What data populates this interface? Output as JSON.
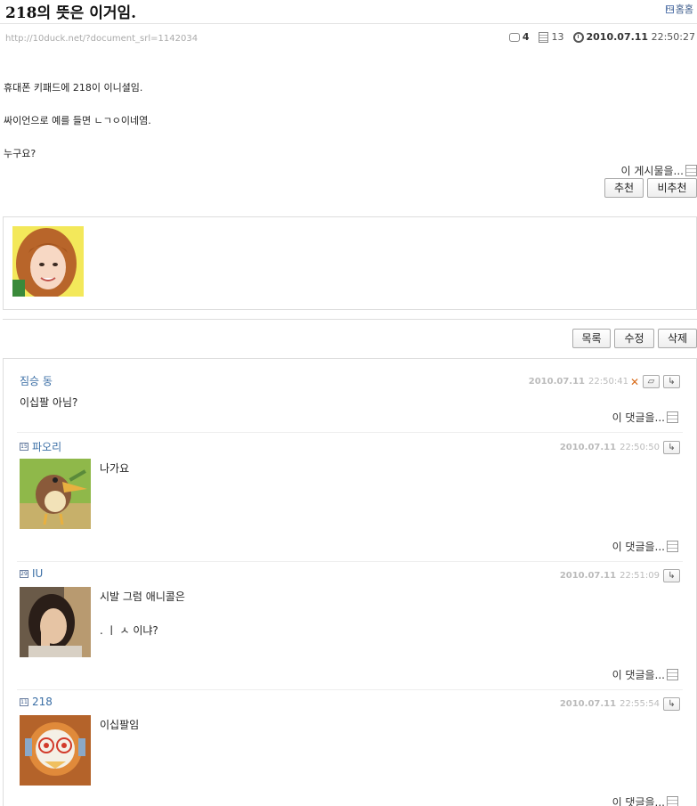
{
  "post": {
    "title": "218의 뜻은 이거임.",
    "home_label": "홈홈",
    "url": "http://10duck.net/?document_srl=1142034",
    "comment_count": "4",
    "view_count": "13",
    "date": "2010.07.11",
    "time": "22:50:27",
    "body": [
      "휴대폰 키패드에 218이 이니셜임.",
      "싸이언으로 예를 들면 ㄴㄱㅇ이네염.",
      "누구요?"
    ],
    "attach_label": "이 게시물을...",
    "recommend_label": "추천",
    "unrecommend_label": "비추천"
  },
  "actions": {
    "list_label": "목록",
    "edit_label": "수정",
    "delete_label": "삭제"
  },
  "comments": [
    {
      "author": "짐승 동",
      "level": "",
      "date": "2010.07.11",
      "time": "22:50:41",
      "lines": [
        "이십팔 아님?"
      ],
      "reply_label": "이 댓글을..."
    },
    {
      "author": "파오리",
      "level": "15",
      "date": "2010.07.11",
      "time": "22:50:50",
      "lines": [
        "나가요"
      ],
      "reply_label": "이 댓글을..."
    },
    {
      "author": "IU",
      "level": "29",
      "date": "2010.07.11",
      "time": "22:51:09",
      "lines": [
        "시발 그럼 애니콜은",
        ". ㅣ ㅅ 이냐?"
      ],
      "reply_label": "이 댓글을..."
    },
    {
      "author": "218",
      "level": "11",
      "date": "2010.07.11",
      "time": "22:55:54",
      "lines": [
        "이십팔임"
      ],
      "reply_label": "이 댓글을..."
    }
  ]
}
